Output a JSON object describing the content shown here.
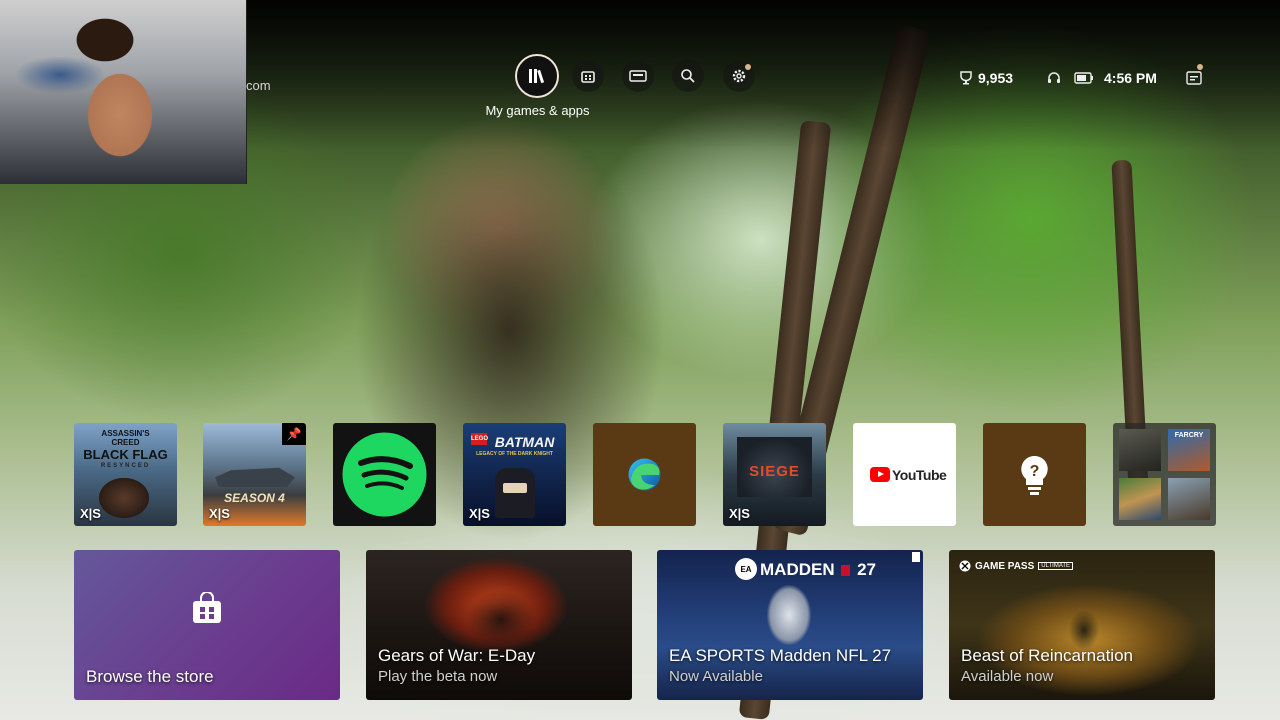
{
  "webcam": {
    "overlay_text": "com"
  },
  "nav": {
    "active_label": "My games & apps",
    "items": [
      {
        "name": "my-games-apps",
        "icon": "library-icon"
      },
      {
        "name": "store",
        "icon": "store-icon"
      },
      {
        "name": "game-pass",
        "icon": "game-pass-icon"
      },
      {
        "name": "search",
        "icon": "search-icon"
      },
      {
        "name": "settings",
        "icon": "gear-icon"
      }
    ]
  },
  "status": {
    "gamerscore": "9,953",
    "time": "4:56 PM"
  },
  "tiles": [
    {
      "name": "assassins-creed",
      "line1": "ASSASSIN'S",
      "line2": "CREED",
      "line3": "BLACK FLAG",
      "line4": "RESYNCED",
      "badge": "X|S"
    },
    {
      "name": "battlefield",
      "line1": "SEASON 4",
      "badge": "X|S"
    },
    {
      "name": "spotify"
    },
    {
      "name": "lego-batman",
      "line1": "LEGO",
      "line2": "BATMAN",
      "line3": "LEGACY OF THE DARK KNIGHT",
      "badge": "X|S"
    },
    {
      "name": "edge"
    },
    {
      "name": "siege",
      "line1": "SIEGE",
      "badge": "X|S"
    },
    {
      "name": "youtube",
      "label": "YouTube"
    },
    {
      "name": "tips"
    },
    {
      "name": "group",
      "line1": "FARCRY"
    }
  ],
  "cards": [
    {
      "name": "browse-store",
      "title": "Browse the store"
    },
    {
      "name": "gears-of-war",
      "title": "Gears of War: E-Day",
      "subtitle": "Play the beta now"
    },
    {
      "name": "madden",
      "title": "EA SPORTS Madden NFL 27",
      "subtitle": "Now Available",
      "logo": "MADDEN",
      "logo_num": "27"
    },
    {
      "name": "beast-of-reincarnation",
      "title": "Beast of Reincarnation",
      "subtitle": "Available now",
      "logo": "GAME PASS",
      "logo_badge": "ULTIMATE"
    }
  ],
  "colors": {
    "spotify_green": "#1ed760",
    "brown_tile": "#5a3a14",
    "store_purple": "#6c3f93",
    "youtube_red": "#ff0000"
  }
}
